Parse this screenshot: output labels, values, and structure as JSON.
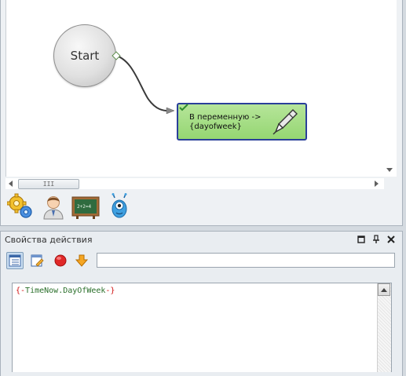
{
  "canvas": {
    "start_node_label": "Start",
    "action_node_label": "В переменную ->\n{dayofweek}",
    "hscroll_thumb_grip": "III",
    "toolbox_icons": [
      "gears-icon",
      "user-icon",
      "chalkboard-icon",
      "blue-monster-icon"
    ]
  },
  "properties_panel": {
    "title": "Свойства действия",
    "window_controls": [
      "maximize-icon",
      "pin-icon",
      "close-icon"
    ],
    "toolbar_icons": [
      "properties-grid-icon",
      "edit-icon",
      "stop-icon",
      "down-arrow-icon"
    ],
    "input_value": "",
    "editor": {
      "open_brace": "{-",
      "expression": "TimeNow.DayOfWeek",
      "close_brace": "-}"
    }
  },
  "colors": {
    "action_node_fill": "#a5de82",
    "action_node_border": "#2a3f9a",
    "code_brace": "#d01010",
    "code_identifier": "#2a6f2a"
  }
}
